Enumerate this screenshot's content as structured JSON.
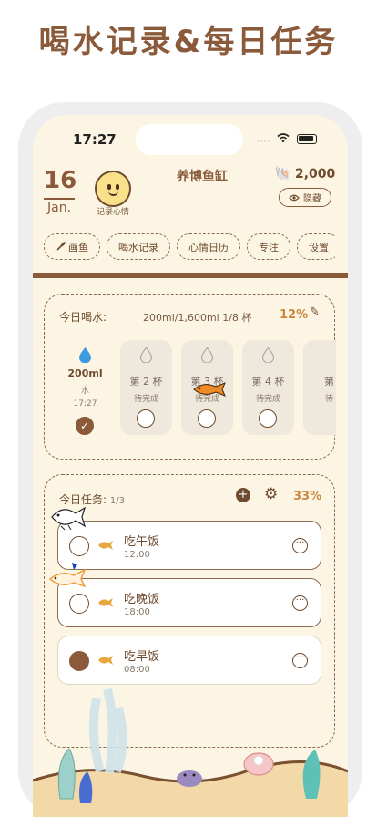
{
  "promo_headline": "喝水记录&每日任务",
  "status_bar": {
    "time": "17:27",
    "dots": "····"
  },
  "header": {
    "date_day": "16",
    "date_month": "Jan.",
    "mood_label": "记录心情",
    "app_title": "养博鱼缸",
    "coin_count": "2,000",
    "hide_label": "隐藏"
  },
  "tabs": [
    {
      "label": "画鱼",
      "icon": "fish-brush-icon"
    },
    {
      "label": "喝水记录"
    },
    {
      "label": "心情日历"
    },
    {
      "label": "专注"
    },
    {
      "label": "设置"
    }
  ],
  "water": {
    "label": "今日喝水:",
    "progress": "200ml/1,600ml  1/8 杯",
    "percent": "12%",
    "cups": [
      {
        "name": "200ml",
        "sub": "水",
        "time": "17:27",
        "done": true
      },
      {
        "name": "第 2 杯",
        "sub": "待完成"
      },
      {
        "name": "第 3 杯",
        "sub": "待完成"
      },
      {
        "name": "第 4 杯",
        "sub": "待完成"
      },
      {
        "name": "第",
        "sub": "待"
      }
    ]
  },
  "tasks": {
    "label": "今日任务:",
    "count": "1/3",
    "percent": "33%",
    "add_label": "+",
    "items": [
      {
        "title": "吃午饭",
        "time": "12:00",
        "done": false
      },
      {
        "title": "吃晚饭",
        "time": "18:00",
        "done": false
      },
      {
        "title": "吃早饭",
        "time": "08:00",
        "done": true
      }
    ]
  },
  "colors": {
    "brown": "#8a5a3a",
    "cream": "#fdf5e3",
    "accent": "#c88a40",
    "fish": "#e8a840"
  }
}
